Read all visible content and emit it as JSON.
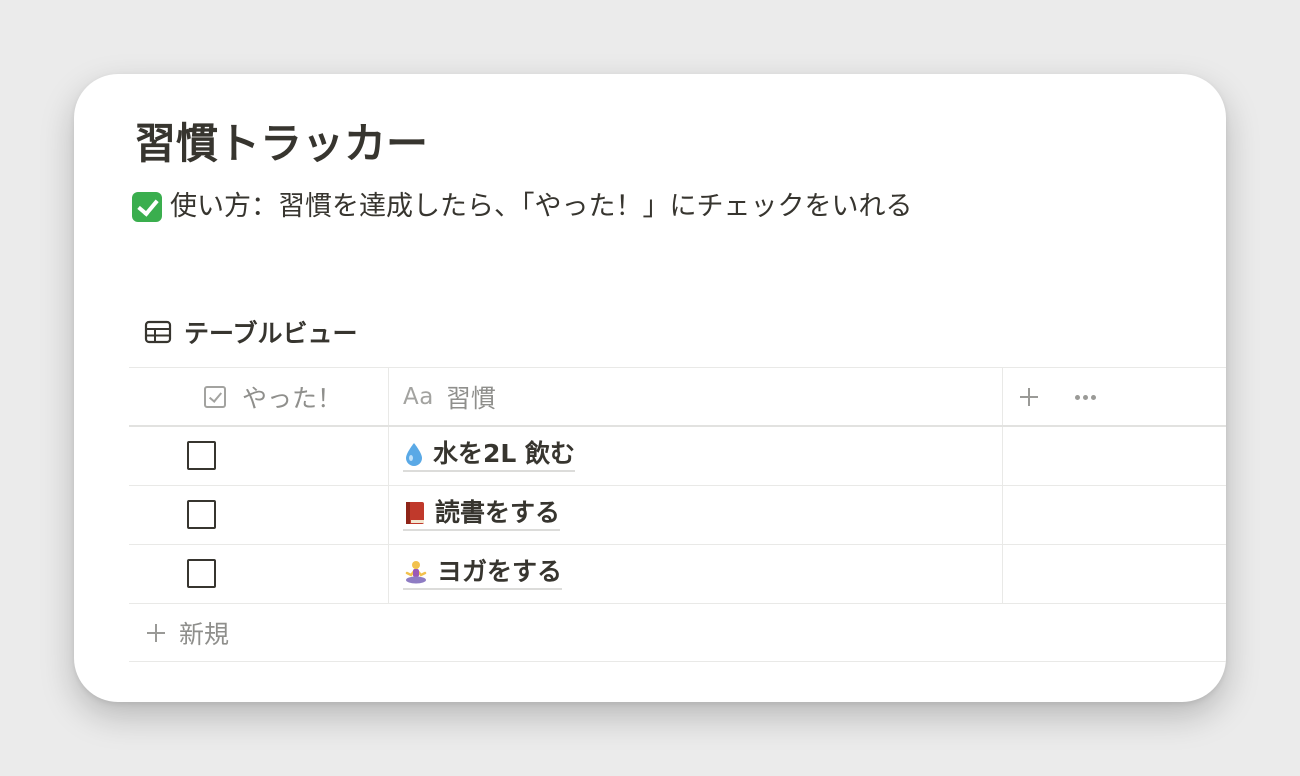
{
  "page": {
    "title": "習慣トラッカー",
    "description": "使い方：習慣を達成したら、「やった！」にチェックをいれる"
  },
  "view": {
    "label": "テーブルビュー",
    "icon": "table-icon"
  },
  "table": {
    "columns": [
      {
        "label": "やった！",
        "type_icon": "checkbox-icon"
      },
      {
        "label": "習慣",
        "type_prefix": "Aa"
      }
    ],
    "add_column_label": "+",
    "rows": [
      {
        "done": false,
        "emoji": "droplet-icon",
        "title": "水を2L 飲む"
      },
      {
        "done": false,
        "emoji": "book-icon",
        "title": "読書をする"
      },
      {
        "done": false,
        "emoji": "yoga-person-icon",
        "title": "ヨガをする"
      }
    ],
    "new_row_label": "新規"
  },
  "colors": {
    "text": "#37352f",
    "muted": "#8f8f8c",
    "check_green": "#3aae4e",
    "background": "#ebebeb"
  }
}
